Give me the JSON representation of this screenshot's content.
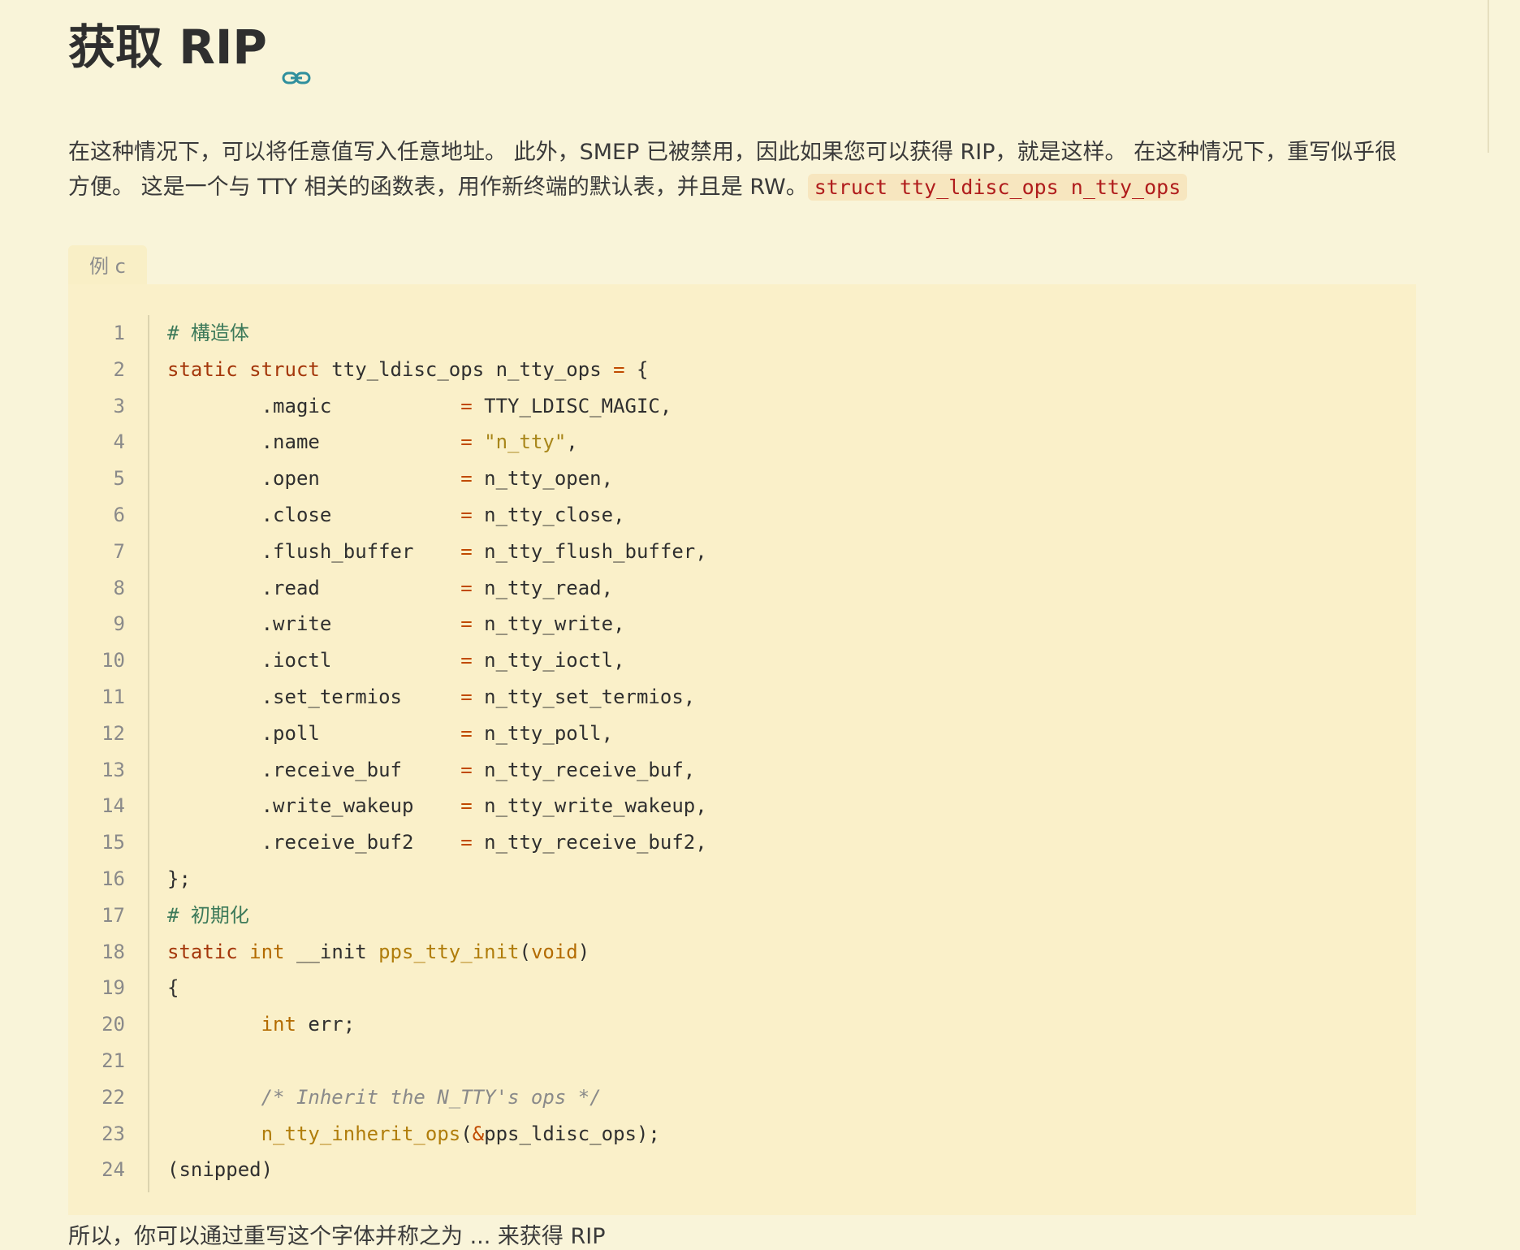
{
  "heading": {
    "title": "获取 RIP",
    "anchor_icon": "link-icon"
  },
  "paragraph": {
    "text": "在这种情况下，可以将任意值写入任意地址。 此外，SMEP 已被禁用，因此如果您可以获得 RIP，就是这样。 在这种情况下，重写似乎很方便。 这是一个与 TTY 相关的函数表，用作新终端的默认表，并且是 RW。",
    "inline_code": "struct tty_ldisc_ops n_tty_ops"
  },
  "code_block": {
    "tab_label": "例 c",
    "lines": [
      {
        "n": "1"
      },
      {
        "n": "2"
      },
      {
        "n": "3"
      },
      {
        "n": "4"
      },
      {
        "n": "5"
      },
      {
        "n": "6"
      },
      {
        "n": "7"
      },
      {
        "n": "8"
      },
      {
        "n": "9"
      },
      {
        "n": "10"
      },
      {
        "n": "11"
      },
      {
        "n": "12"
      },
      {
        "n": "13"
      },
      {
        "n": "14"
      },
      {
        "n": "15"
      },
      {
        "n": "16"
      },
      {
        "n": "17"
      },
      {
        "n": "18"
      },
      {
        "n": "19"
      },
      {
        "n": "20"
      },
      {
        "n": "21"
      },
      {
        "n": "22"
      },
      {
        "n": "23"
      },
      {
        "n": "24"
      }
    ],
    "tokens": {
      "l1": "# 構造体",
      "l2_kw1": "static",
      "l2_kw2": "struct",
      "l2_rest": " tty_ldisc_ops n_tty_ops ",
      "l2_eq": "=",
      "l2_brace": " {",
      "l3_field": "        .magic           ",
      "l3_val": " TTY_LDISC_MAGIC,",
      "l4_field": "        .name            ",
      "l4_val": "\"n_tty\"",
      "l4_comma": ",",
      "l5_field": "        .open            ",
      "l5_val": " n_tty_open,",
      "l6_field": "        .close           ",
      "l6_val": " n_tty_close,",
      "l7_field": "        .flush_buffer    ",
      "l7_val": " n_tty_flush_buffer,",
      "l8_field": "        .read            ",
      "l8_val": " n_tty_read,",
      "l9_field": "        .write           ",
      "l9_val": " n_tty_write,",
      "l10_field": "        .ioctl           ",
      "l10_val": " n_tty_ioctl,",
      "l11_field": "        .set_termios     ",
      "l11_val": " n_tty_set_termios,",
      "l12_field": "        .poll            ",
      "l12_val": " n_tty_poll,",
      "l13_field": "        .receive_buf     ",
      "l13_val": " n_tty_receive_buf,",
      "l14_field": "        .write_wakeup    ",
      "l14_val": " n_tty_write_wakeup,",
      "l15_field": "        .receive_buf2    ",
      "l15_val": " n_tty_receive_buf2,",
      "l16": "};",
      "l17": "# 初期化",
      "l18_kw": "static",
      "l18_type": "int",
      "l18_mid": " __init ",
      "l18_func": "pps_tty_init",
      "l18_paren": "(",
      "l18_void": "void",
      "l18_end": ")",
      "l19": "{",
      "l20_indent": "        ",
      "l20_type": "int",
      "l20_rest": " err;",
      "l21": "",
      "l22_indent": "        ",
      "l22_comment": "/* Inherit the N_TTY's ops */",
      "l23_indent": "        ",
      "l23_func": "n_tty_inherit_ops",
      "l23_p": "(",
      "l23_amp": "&",
      "l23_rest": "pps_ldisc_ops);",
      "l24": "(snipped)",
      "eq": "="
    }
  },
  "bottom_text": "所以，你可以通过重写这个字体并称之为 ... 来获得 RIP"
}
